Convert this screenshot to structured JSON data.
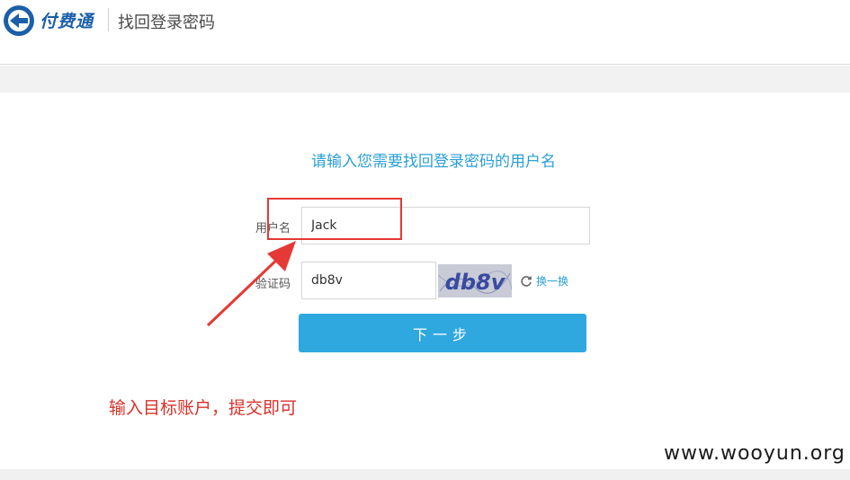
{
  "header": {
    "logo_text": "付费通",
    "title": "找回登录密码"
  },
  "form": {
    "prompt": "请输入您需要找回登录密码的用户名",
    "username_label": "用户名",
    "username_value": "Jack",
    "captcha_label": "验证码",
    "captcha_value": "db8v",
    "captcha_image_text": "db8v",
    "refresh_label": "换一换",
    "next_button": "下一步"
  },
  "annotation": {
    "text": "输入目标账户，提交即可",
    "color": "#d9312a"
  },
  "watermark": "www.wooyun.org",
  "colors": {
    "accent": "#2fa8e0",
    "prompt": "#2a9fd6",
    "annotation": "#e53935"
  }
}
